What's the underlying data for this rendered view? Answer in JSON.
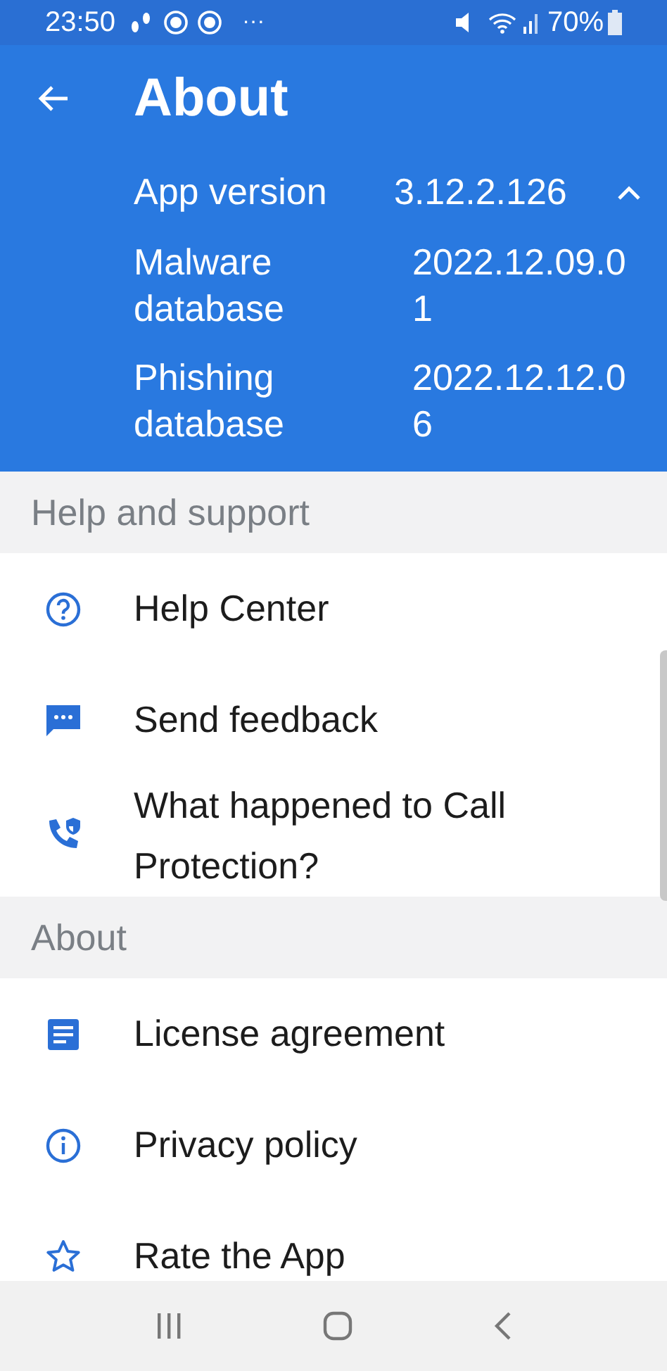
{
  "status_bar": {
    "time": "23:50",
    "more": "···",
    "battery": "70%"
  },
  "header": {
    "title": "About"
  },
  "version_info": {
    "expanded": true,
    "rows": [
      {
        "label": "App version",
        "value": "3.12.2.126"
      },
      {
        "label": "Malware database",
        "value": "2022.12.09.01"
      },
      {
        "label": "Phishing database",
        "value": "2022.12.12.06"
      }
    ]
  },
  "sections": [
    {
      "title": "Help and support",
      "items": [
        {
          "kind": "help",
          "label": "Help Center"
        },
        {
          "kind": "feedback",
          "label": "Send feedback"
        },
        {
          "kind": "call",
          "label": "What happened to Call Protection?"
        }
      ]
    },
    {
      "title": "About",
      "items": [
        {
          "kind": "license",
          "label": "License agreement"
        },
        {
          "kind": "privacy",
          "label": "Privacy policy"
        },
        {
          "kind": "rate",
          "label": "Rate the App"
        }
      ]
    }
  ]
}
